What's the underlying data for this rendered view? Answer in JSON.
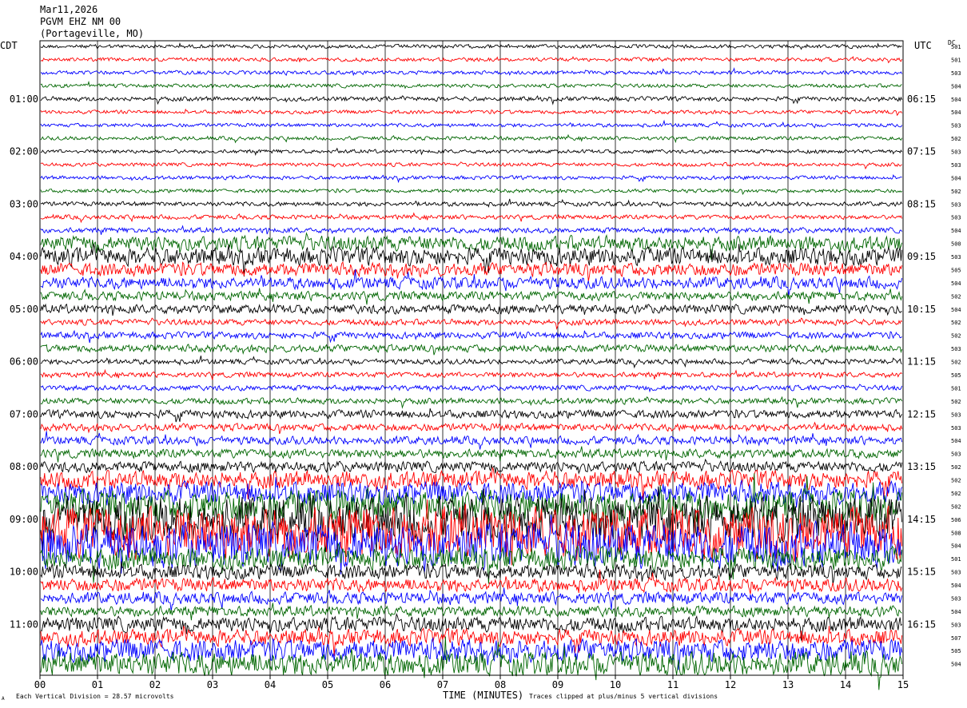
{
  "header": {
    "date": "Mar11,2026",
    "station": "PGVM EHZ NM 00",
    "location": "(Portageville, MO)"
  },
  "left_axis_title": "CDT",
  "right_axis_title": "UTC",
  "dc_title": "DC",
  "footer": {
    "scale_note": "Each Vertical Division =   28.57 microvolts",
    "xlabel": "TIME (MINUTES)",
    "clip_note": "Traces clipped at plus/minus 5 vertical divisions",
    "corner_mark": "A"
  },
  "chart_data": {
    "type": "line",
    "title": "PGVM EHZ NM 00",
    "xlabel": "TIME (MINUTES)",
    "xlim": [
      0,
      15
    ],
    "x_ticks": [
      "00",
      "01",
      "02",
      "03",
      "04",
      "05",
      "06",
      "07",
      "08",
      "09",
      "10",
      "11",
      "12",
      "13",
      "14",
      "15"
    ],
    "left_time_labels": [
      "01:00",
      "02:00",
      "03:00",
      "04:00",
      "05:00",
      "06:00",
      "07:00",
      "08:00",
      "09:00",
      "10:00",
      "11:00"
    ],
    "right_time_labels": [
      "06:15",
      "07:15",
      "08:15",
      "09:15",
      "10:15",
      "11:15",
      "12:15",
      "13:15",
      "14:15",
      "15:15",
      "16:15"
    ],
    "trace_colors": [
      "#000000",
      "#ff0000",
      "#0000ff",
      "#006600"
    ],
    "dc_offsets": [
      "501",
      "501",
      "503",
      "504",
      "504",
      "504",
      "503",
      "502",
      "503",
      "503",
      "504",
      "502",
      "503",
      "503",
      "504",
      "500",
      "503",
      "505",
      "504",
      "502",
      "504",
      "502",
      "502",
      "503",
      "502",
      "505",
      "501",
      "502",
      "503",
      "503",
      "504",
      "503",
      "502",
      "502",
      "502",
      "502",
      "506",
      "508",
      "504",
      "501",
      "503",
      "504",
      "503",
      "504",
      "503",
      "507",
      "505",
      "504"
    ],
    "trace_amplitude_divisions": [
      0.25,
      0.25,
      0.25,
      0.25,
      0.3,
      0.25,
      0.25,
      0.25,
      0.25,
      0.25,
      0.25,
      0.25,
      0.3,
      0.3,
      0.35,
      1.0,
      1.2,
      0.9,
      0.8,
      0.6,
      0.6,
      0.4,
      0.45,
      0.5,
      0.35,
      0.35,
      0.35,
      0.4,
      0.55,
      0.5,
      0.55,
      0.6,
      0.7,
      1.2,
      1.5,
      2.2,
      3.0,
      3.5,
      3.0,
      1.5,
      1.0,
      0.9,
      0.8,
      0.7,
      1.0,
      1.1,
      1.5,
      1.6
    ],
    "clip_divisions": 5,
    "scale_microvolts_per_division": 28.57
  }
}
